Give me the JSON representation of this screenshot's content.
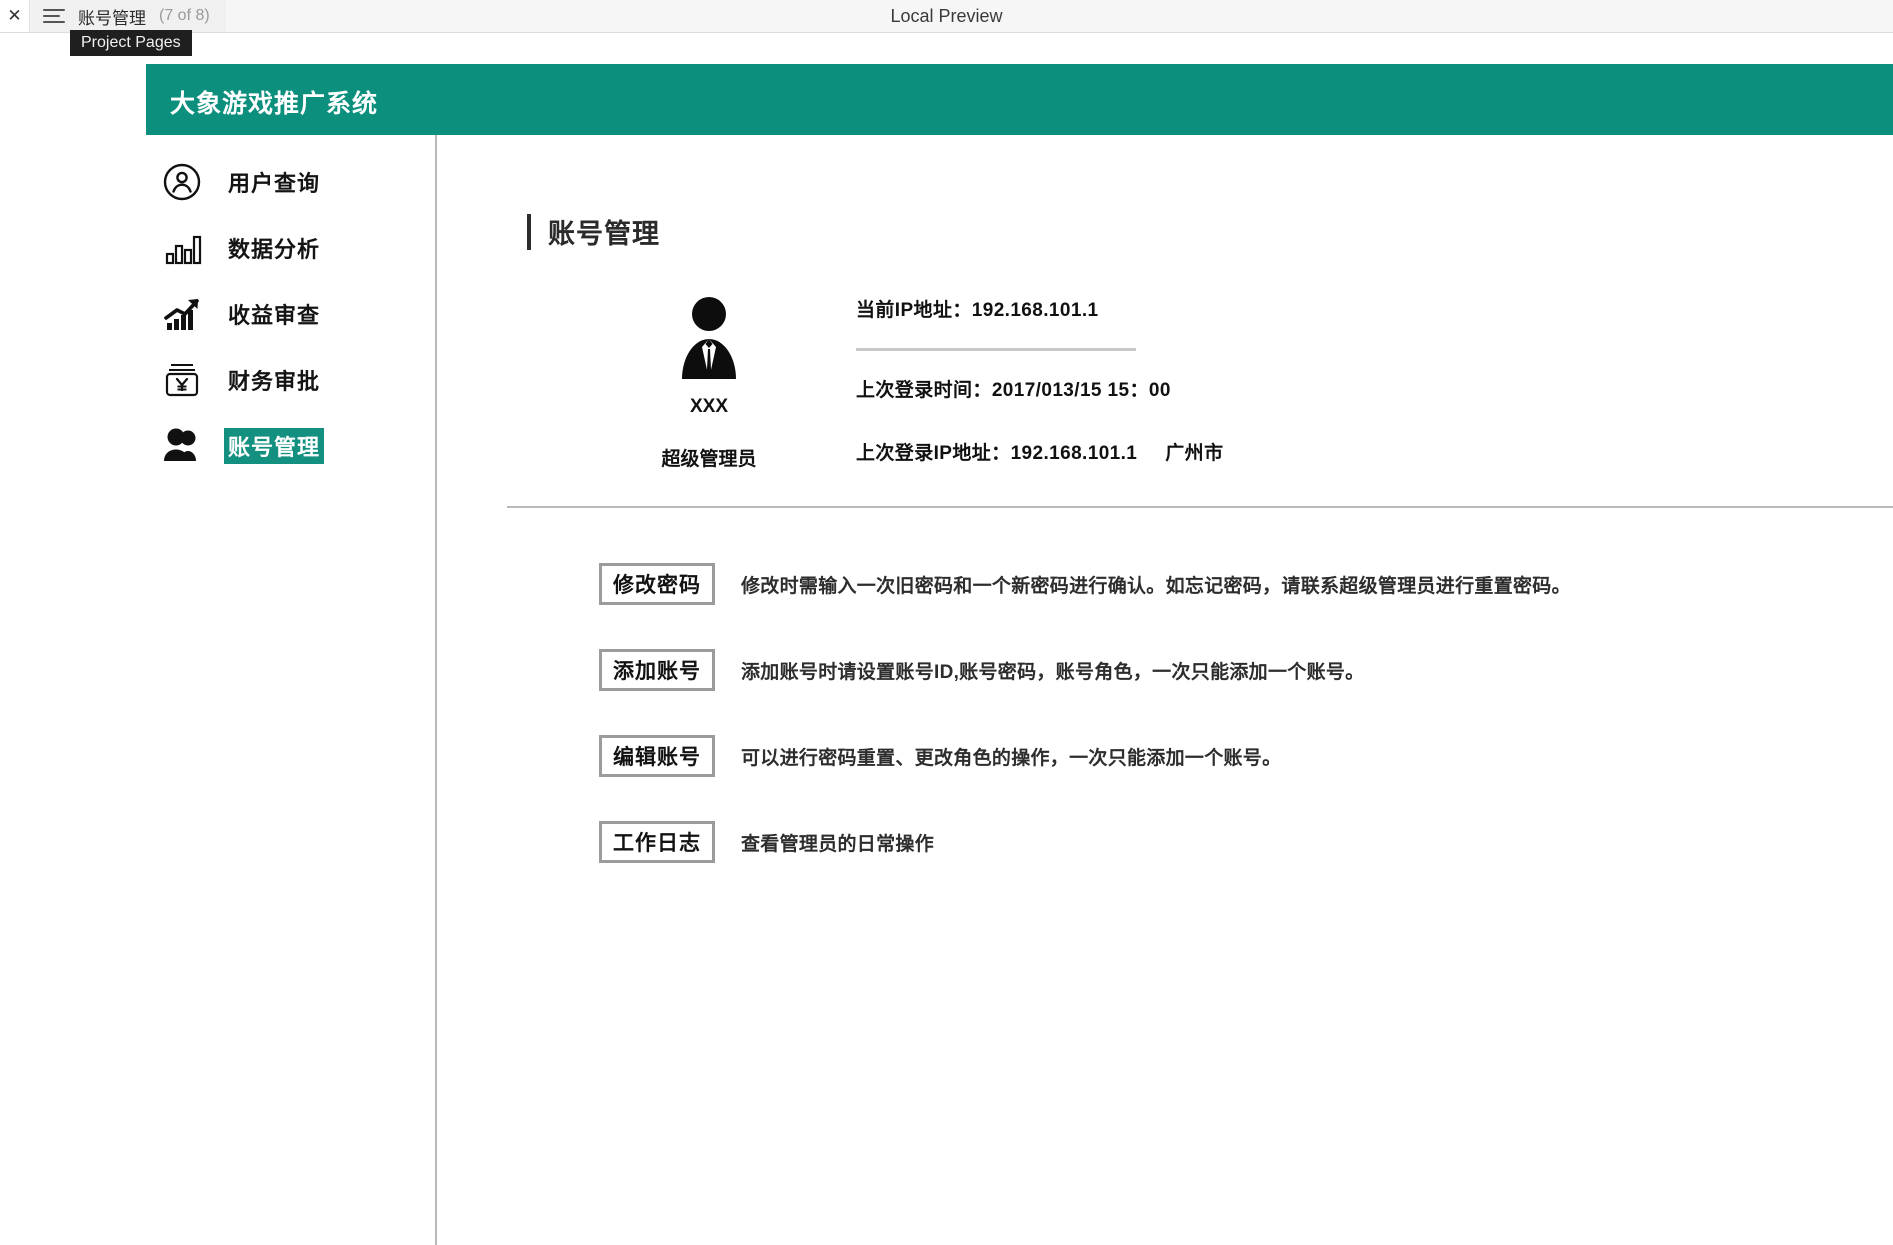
{
  "chrome": {
    "close_icon": "close-icon",
    "menu_icon": "hamburger-icon",
    "tab_title": "账号管理",
    "tab_count": "(7 of 8)",
    "preview_label": "Local Preview",
    "tooltip": "Project Pages"
  },
  "app": {
    "title": "大象游戏推广系统",
    "accent_color": "#0d8f7e",
    "highlight_color": "#13907f"
  },
  "sidebar": {
    "items": [
      {
        "label": "用户查询",
        "icon": "user-circle-icon",
        "selected": false
      },
      {
        "label": "数据分析",
        "icon": "bar-chart-icon",
        "selected": false
      },
      {
        "label": "收益审查",
        "icon": "trending-up-chart-icon",
        "selected": false
      },
      {
        "label": "财务审批",
        "icon": "yen-banknote-icon",
        "selected": false
      },
      {
        "label": "账号管理",
        "icon": "users-icon",
        "selected": true
      }
    ]
  },
  "main": {
    "page_title": "账号管理",
    "profile": {
      "avatar_icon": "business-person-avatar-icon",
      "name": "XXX",
      "role": "超级管理员",
      "current_ip_label": "当前IP地址：",
      "current_ip_value": "192.168.101.1",
      "last_login_label": "上次登录时间：",
      "last_login_value": "2017/013/15  15：00",
      "last_ip_label": "上次登录IP地址：",
      "last_ip_value": "192.168.101.1",
      "last_ip_city": "广州市"
    },
    "actions": [
      {
        "button": "修改密码",
        "desc": "修改时需输入一次旧密码和一个新密码进行确认。如忘记密码，请联系超级管理员进行重置密码。"
      },
      {
        "button": "添加账号",
        "desc": "添加账号时请设置账号ID,账号密码，账号角色，一次只能添加一个账号。"
      },
      {
        "button": "编辑账号",
        "desc": "可以进行密码重置、更改角色的操作，一次只能添加一个账号。"
      },
      {
        "button": "工作日志",
        "desc": "查看管理员的日常操作"
      }
    ]
  }
}
